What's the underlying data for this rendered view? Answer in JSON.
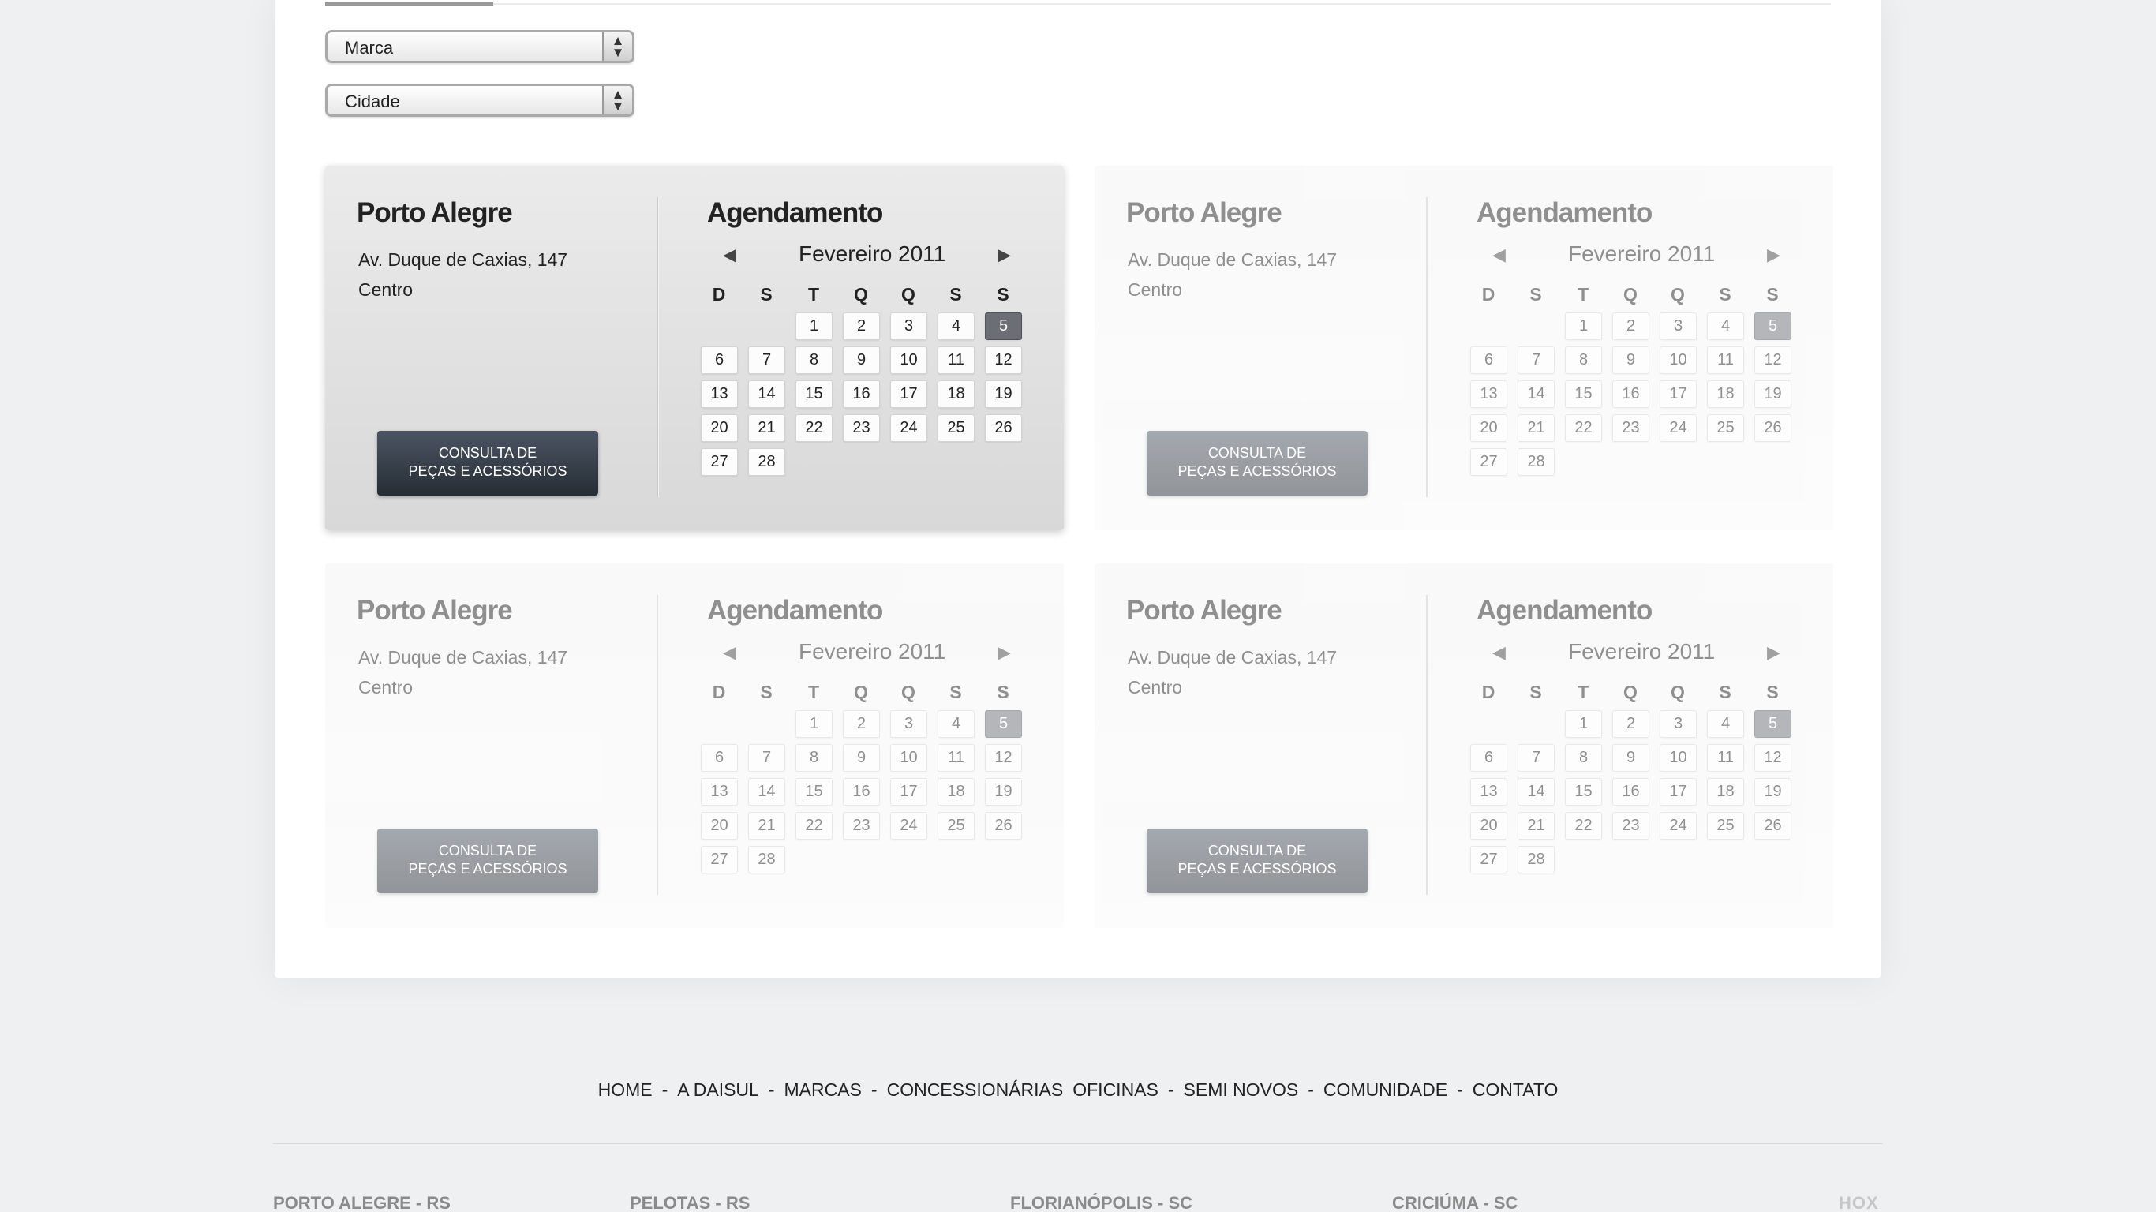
{
  "filters": {
    "brand": "Marca",
    "city": "Cidade"
  },
  "cards": [
    {
      "city": "Porto Alegre",
      "address_line1": "Av. Duque de Caxias, 147",
      "address_line2": "Centro",
      "button_line1": "CONSULTA DE",
      "button_line2": "PEÇAS E ACESSÓRIOS",
      "schedule_title": "Agendamento",
      "month": "Fevereiro 2011",
      "state": "active"
    },
    {
      "city": "Porto Alegre",
      "address_line1": "Av. Duque de Caxias, 147",
      "address_line2": "Centro",
      "button_line1": "CONSULTA DE",
      "button_line2": "PEÇAS E ACESSÓRIOS",
      "schedule_title": "Agendamento",
      "month": "Fevereiro 2011",
      "state": "faded"
    },
    {
      "city": "Porto Alegre",
      "address_line1": "Av. Duque de Caxias, 147",
      "address_line2": "Centro",
      "button_line1": "CONSULTA DE",
      "button_line2": "PEÇAS E ACESSÓRIOS",
      "schedule_title": "Agendamento",
      "month": "Fevereiro 2011",
      "state": "faded"
    },
    {
      "city": "Porto Alegre",
      "address_line1": "Av. Duque de Caxias, 147",
      "address_line2": "Centro",
      "button_line1": "CONSULTA DE",
      "button_line2": "PEÇAS E ACESSÓRIOS",
      "schedule_title": "Agendamento",
      "month": "Fevereiro 2011",
      "state": "faded"
    }
  ],
  "calendar": {
    "weekdays": [
      "D",
      "S",
      "T",
      "Q",
      "Q",
      "S",
      "S"
    ],
    "first_weekday_index": 2,
    "days_in_month": 28,
    "selected_day": 5,
    "prev_icon": "arrow-left-icon",
    "next_icon": "arrow-right-icon"
  },
  "footer": {
    "nav": [
      "HOME",
      "A DAISUL",
      "MARCAS",
      "CONCESSIONÁRIAS",
      "OFICINAS",
      "SEMI NOVOS",
      "COMUNIDADE",
      "CONTATO"
    ],
    "separators": [
      "-",
      "-",
      "-",
      "",
      "-",
      "-",
      "-"
    ],
    "cities": [
      "PORTO ALEGRE - RS",
      "PELOTAS - RS",
      "FLORIANÓPOLIS - SC",
      "CRICIÚMA - SC"
    ],
    "logo": "HOX"
  }
}
